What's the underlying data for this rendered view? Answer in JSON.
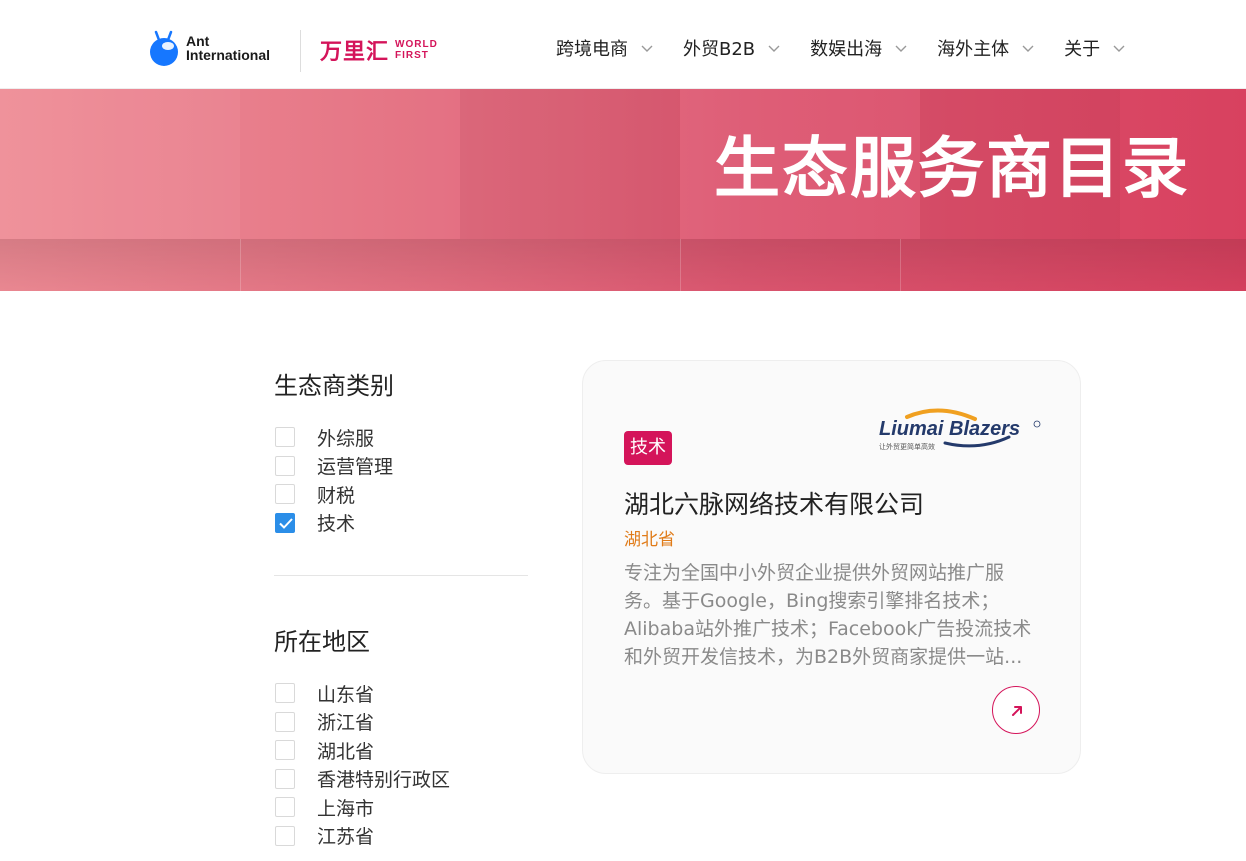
{
  "header": {
    "ant_brand_line1": "Ant",
    "ant_brand_line2": "International",
    "wf_brand_cn": "万里汇",
    "wf_brand_en_line1": "WORLD",
    "wf_brand_en_line2": "FIRST",
    "nav": [
      {
        "label": "跨境电商"
      },
      {
        "label": "外贸B2B"
      },
      {
        "label": "数娱出海"
      },
      {
        "label": "海外主体"
      },
      {
        "label": "关于"
      }
    ]
  },
  "banner": {
    "title": "生态服务商目录"
  },
  "filters": {
    "category": {
      "title": "生态商类别",
      "options": [
        {
          "label": "外综服",
          "checked": false
        },
        {
          "label": "运营管理",
          "checked": false
        },
        {
          "label": "财税",
          "checked": false
        },
        {
          "label": "技术",
          "checked": true
        }
      ]
    },
    "region": {
      "title": "所在地区",
      "options": [
        {
          "label": "山东省",
          "checked": false
        },
        {
          "label": "浙江省",
          "checked": false
        },
        {
          "label": "湖北省",
          "checked": false
        },
        {
          "label": "香港特别行政区",
          "checked": false
        },
        {
          "label": "上海市",
          "checked": false
        },
        {
          "label": "江苏省",
          "checked": false
        }
      ]
    }
  },
  "card": {
    "tag": "技术",
    "logo_text": "Liumai Blazers",
    "logo_subtext": "让外贸更简单高效",
    "name": "湖北六脉网络技术有限公司",
    "region": "湖北省",
    "description": "专注为全国中小外贸企业提供外贸网站推广服务。基于Google，Bing搜索引擎排名技术；Alibaba站外推广技术；Facebook广告投流技术和外贸开发信技术，为B2B外贸商家提供一站..."
  },
  "colors": {
    "brand_red": "#d4145a",
    "region_orange": "#e07b18",
    "checkbox_blue": "#2b8ee8"
  }
}
